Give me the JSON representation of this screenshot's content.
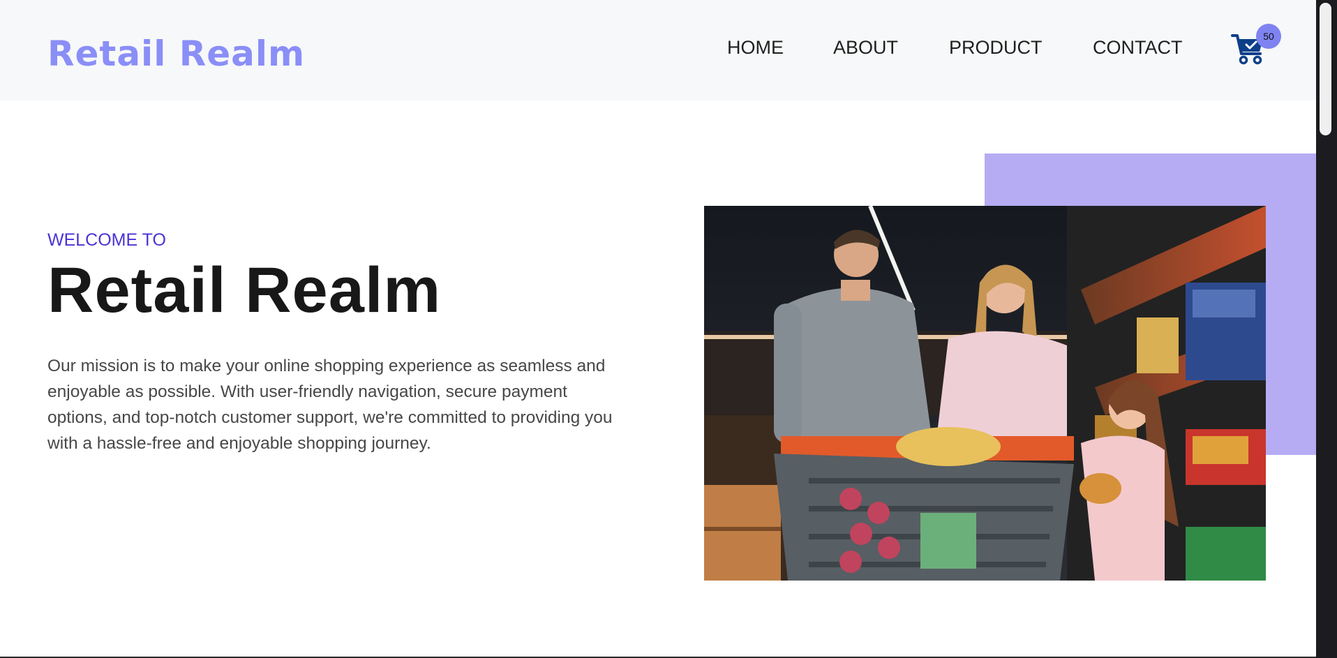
{
  "header": {
    "brand": "Retail Realm",
    "nav": [
      {
        "label": "HOME"
      },
      {
        "label": "ABOUT"
      },
      {
        "label": "PRODUCT"
      },
      {
        "label": "CONTACT"
      }
    ],
    "cart": {
      "count": "50",
      "icon": "shopping-cart-check-icon"
    }
  },
  "hero": {
    "eyebrow": "WELCOME TO",
    "title": "Retail Realm",
    "mission": "Our mission is to make your online shopping experience as seamless and enjoyable as possible. With user-friendly navigation, secure payment options, and top-notch customer support, we're committed to providing you with a hassle-free and enjoyable shopping journey."
  },
  "colors": {
    "brand": "#8a8ef7",
    "eyebrow": "#4a33d6",
    "accent_block": "#b6acf4",
    "header_bg": "#f7f8f9"
  }
}
